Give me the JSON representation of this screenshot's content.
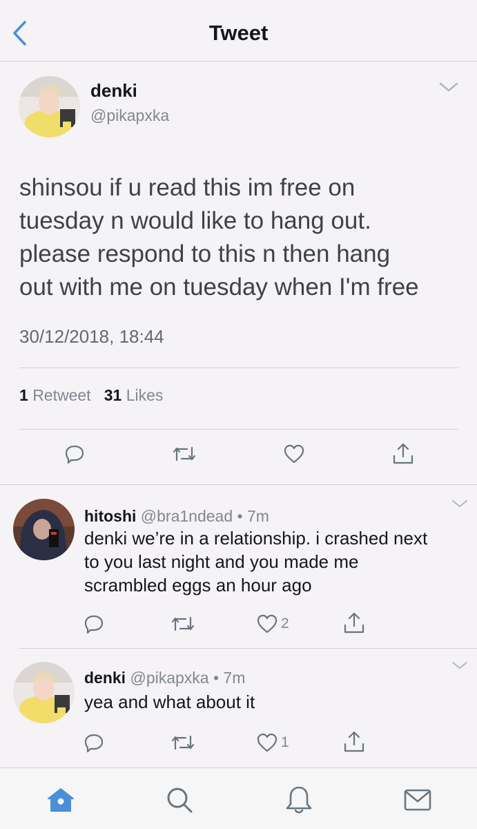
{
  "nav": {
    "title": "Tweet",
    "back_icon": "chevron-left-icon"
  },
  "tweet": {
    "name": "denki",
    "handle": "@pikapxka",
    "text_lines": [
      "shinsou if u read this im free on",
      "tuesday n would like to hang out.",
      "please respond to this n then hang",
      "out with me on tuesday when I'm free"
    ],
    "timestamp": "30/12/2018, 18:44",
    "retweet_count": "1",
    "retweet_label": "Retweet",
    "like_count": "31",
    "like_label": "Likes"
  },
  "replies": [
    {
      "name": "hitoshi",
      "handle": "@bra1ndead",
      "time": "• 7m",
      "text_lines": [
        "denki we’re in a relationship. i crashed next",
        "to you last night and you made me",
        "scrambled eggs an hour ago"
      ],
      "like_count": "2"
    },
    {
      "name": "denki",
      "handle": "@pikapxka",
      "time": "• 7m",
      "text_lines": [
        "yea and what about it"
      ],
      "like_count": "1"
    }
  ],
  "tabbar": [
    "home-icon",
    "search-icon",
    "notifications-icon",
    "messages-icon"
  ],
  "colors": {
    "accent": "#4a8fd8",
    "text": "#14171a",
    "muted": "#7f8891",
    "tweet_text": "#3d4248",
    "background": "#f5f3f5"
  }
}
